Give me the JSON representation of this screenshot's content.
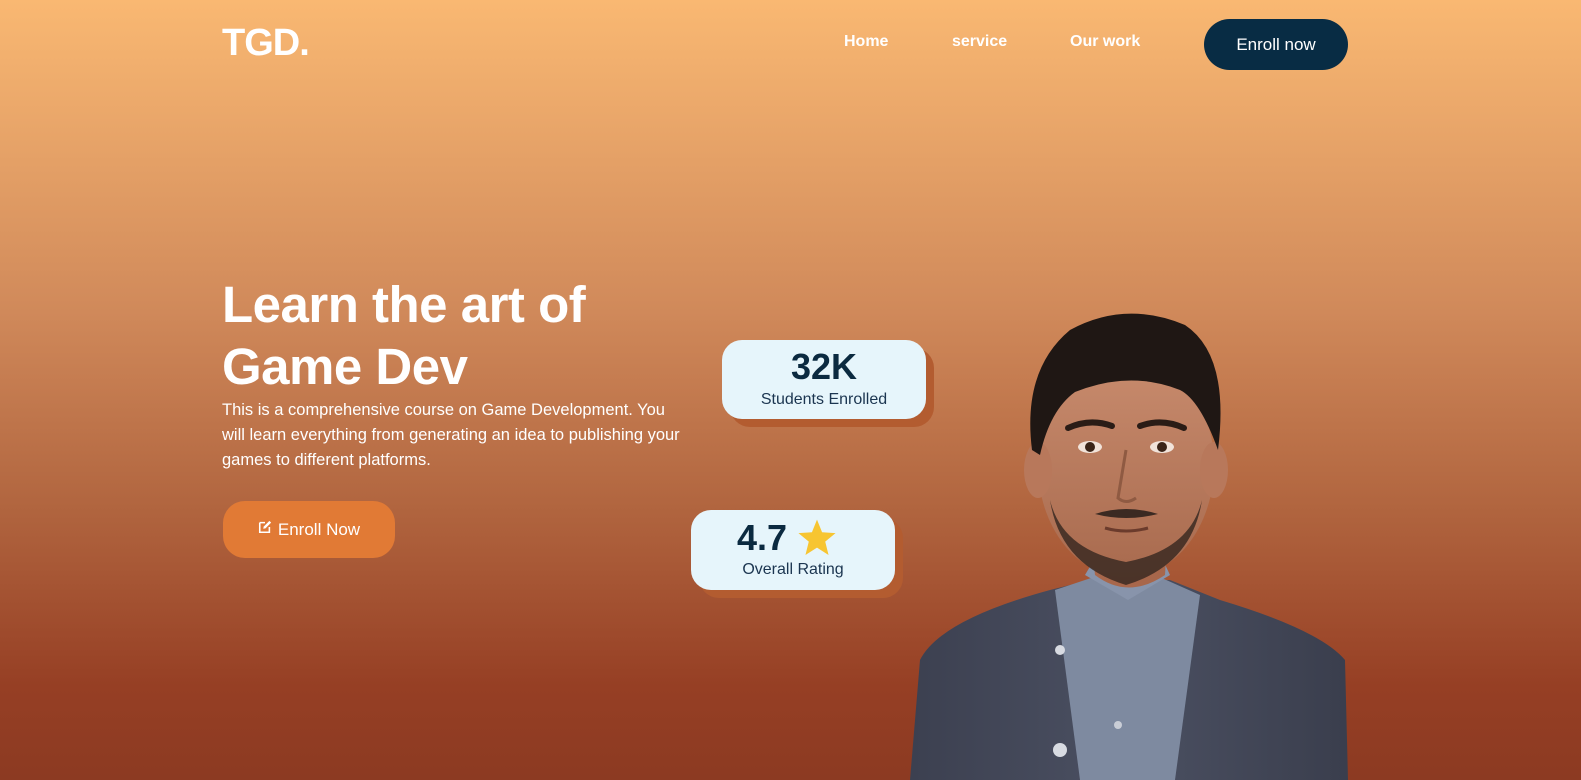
{
  "brand": {
    "logo_text": "TGD."
  },
  "nav": {
    "links": [
      {
        "label": "Home"
      },
      {
        "label": "service"
      },
      {
        "label": "Our work"
      }
    ],
    "cta_label": "Enroll now"
  },
  "hero": {
    "title_line1": "Learn the art of",
    "title_line2": "Game Dev",
    "description": "This is a comprehensive course on Game Development. You will learn everything from generating an idea to publishing your games to different platforms.",
    "cta_label": "Enroll Now",
    "cta_icon": "edit-icon"
  },
  "stats": {
    "students": {
      "value": "32K",
      "label": "Students Enrolled"
    },
    "rating": {
      "value": "4.7",
      "label": "Overall Rating",
      "icon": "star-icon"
    }
  },
  "colors": {
    "nav_cta_bg": "#082c44",
    "hero_cta_bg": "#e17a35",
    "card_bg": "#e6f5fb",
    "star": "#f7c531"
  }
}
